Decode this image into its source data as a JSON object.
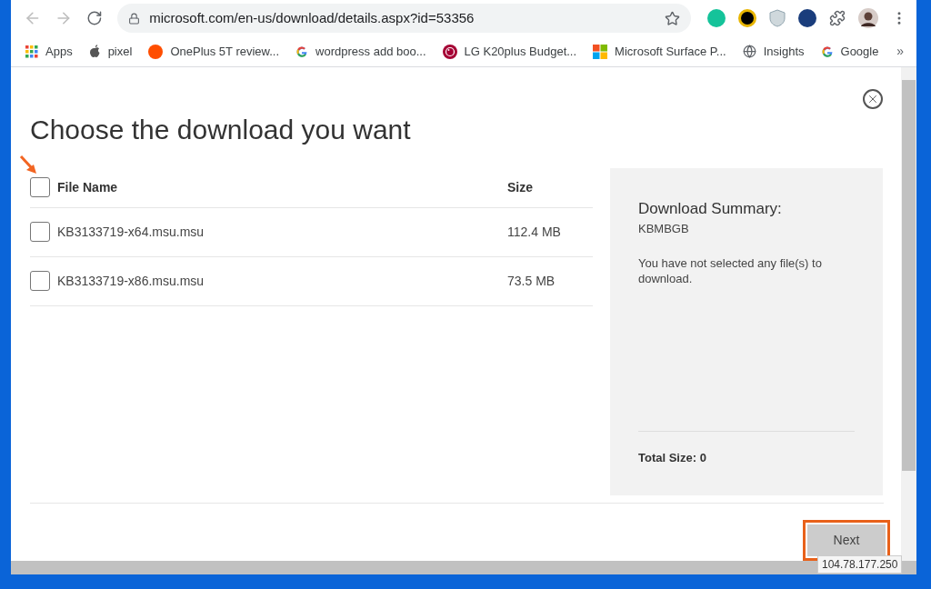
{
  "browser": {
    "address": "microsoft.com/en-us/download/details.aspx?id=53356",
    "bookmarks": [
      {
        "kind": "apps",
        "label": "Apps"
      },
      {
        "kind": "apple",
        "label": "pixel"
      },
      {
        "kind": "ars",
        "label": "OnePlus 5T review..."
      },
      {
        "kind": "google",
        "label": "wordpress add boo..."
      },
      {
        "kind": "lg",
        "label": "LG K20plus Budget..."
      },
      {
        "kind": "windows",
        "label": "Microsoft Surface P..."
      },
      {
        "kind": "globe",
        "label": "Insights"
      },
      {
        "kind": "google",
        "label": "Google"
      }
    ],
    "overflow": "»"
  },
  "dialog": {
    "title": "Choose the download you want",
    "columns": [
      "File Name",
      "Size"
    ],
    "select_all": {
      "checked": false
    },
    "rows": [
      {
        "name": "KB3133719-x64.msu.msu",
        "size": "112.4 MB",
        "checked": false
      },
      {
        "name": "KB3133719-x86.msu.msu",
        "size": "73.5 MB",
        "checked": false
      }
    ],
    "summary": {
      "title": "Download Summary:",
      "subtitle": "KBMBGB",
      "message": "You have not selected any file(s) to download.",
      "total": "Total Size: 0"
    },
    "next_button": "Next"
  },
  "status_url": "104.78.177.250"
}
